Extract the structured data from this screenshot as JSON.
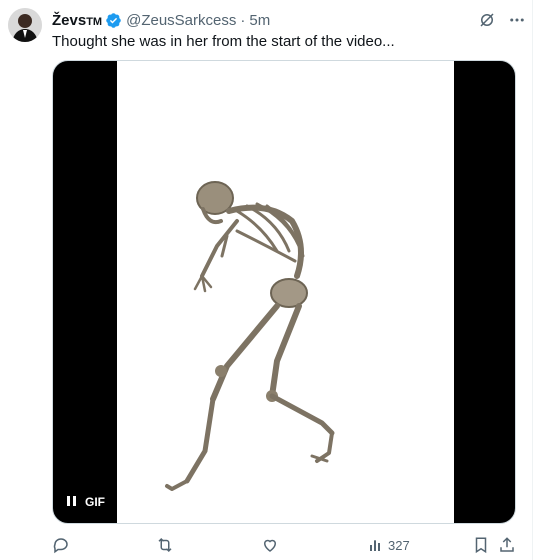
{
  "author": {
    "name": "Ževs",
    "name_suffix": "TM",
    "handle": "@ZeusSarkcess",
    "separator": "·",
    "time": "5m"
  },
  "tweet": {
    "text": "Thought she was in her from the start of the video..."
  },
  "media": {
    "badge": "GIF",
    "state": "paused-icon"
  },
  "actions": {
    "views": "327"
  },
  "colors": {
    "accent": "#1d9bf0",
    "muted": "#536471"
  }
}
